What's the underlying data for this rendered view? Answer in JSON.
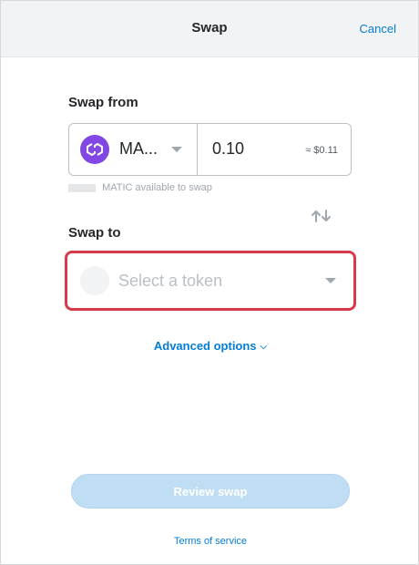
{
  "header": {
    "title": "Swap",
    "cancel_label": "Cancel"
  },
  "swap_from": {
    "label": "Swap from",
    "token_symbol": "MA...",
    "token_color": "#8247e5",
    "amount": "0.10",
    "fiat_estimate": "≈ $0.11",
    "balance_text": "MATIC available to swap"
  },
  "switch": {
    "icon": "swap-arrows-icon"
  },
  "swap_to": {
    "label": "Swap to",
    "placeholder": "Select a token",
    "highlight_color": "#d73a49"
  },
  "advanced": {
    "label": "Advanced options"
  },
  "review_button": {
    "label": "Review swap"
  },
  "footer": {
    "terms_label": "Terms of service"
  },
  "colors": {
    "link": "#037dd6",
    "header_bg": "#f2f3f4"
  }
}
